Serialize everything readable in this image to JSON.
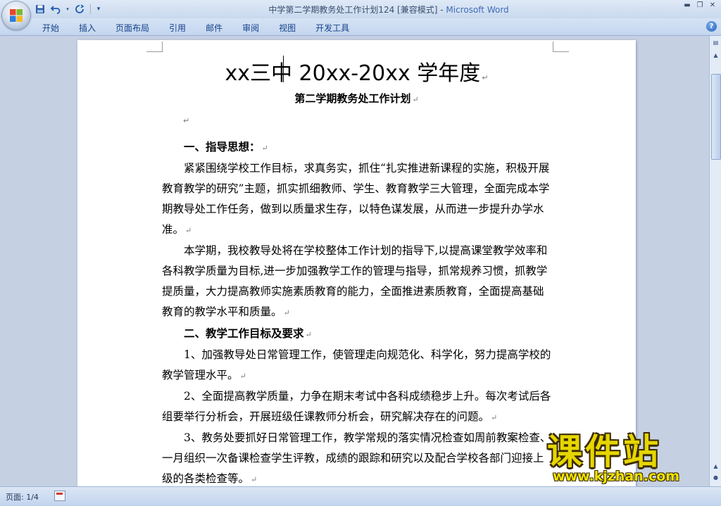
{
  "window": {
    "doc_title": "中学第二学期教务处工作计划124 [兼容模式]",
    "separator": " - ",
    "app_name": "Microsoft Word"
  },
  "ribbon": {
    "tabs": [
      "开始",
      "插入",
      "页面布局",
      "引用",
      "邮件",
      "审阅",
      "视图",
      "开发工具"
    ]
  },
  "document": {
    "title_line1": "xx三中 20xx-20xx 学年度",
    "title_line2": "第二学期教务处工作计划",
    "paragraphs": [
      {
        "type": "heading",
        "text": "一、指导思想："
      },
      {
        "type": "para",
        "text": "紧紧围绕学校工作目标，求真务实，抓住“扎实推进新课程的实施，积极开展教育教学的研究”主题，抓实抓细教师、学生、教育教学三大管理，全面完成本学期教导处工作任务，做到以质量求生存，以特色谋发展，从而进一步提升办学水准。"
      },
      {
        "type": "para",
        "text": "本学期，我校教导处将在学校整体工作计划的指导下,以提高课堂教学效率和各科教学质量为目标,进一步加强教学工作的管理与指导，抓常规养习惯，抓教学提质量，大力提高教师实施素质教育的能力，全面推进素质教育，全面提高基础教育的教学水平和质量。"
      },
      {
        "type": "heading",
        "text": "二、教学工作目标及要求"
      },
      {
        "type": "para",
        "text": "1、加强教导处日常管理工作，使管理走向规范化、科学化，努力提高学校的教学管理水平。"
      },
      {
        "type": "para",
        "text": "2、全面提高教学质量，力争在期末考试中各科成绩稳步上升。每次考试后各组要举行分析会，开展班级任课教师分析会，研究解决存在的问题。"
      },
      {
        "type": "para",
        "text": "3、教务处要抓好日常管理工作，教学常规的落实情况检查如周前教案检查、一月组织一次备课检查学生评教，成绩的跟踪和研究以及配合学校各部门迎接上级的各类检查等。"
      }
    ]
  },
  "watermark": {
    "brand": "课件站",
    "url": "www.kjzhan.com"
  },
  "status": {
    "page_label": "页面: 1/4"
  }
}
